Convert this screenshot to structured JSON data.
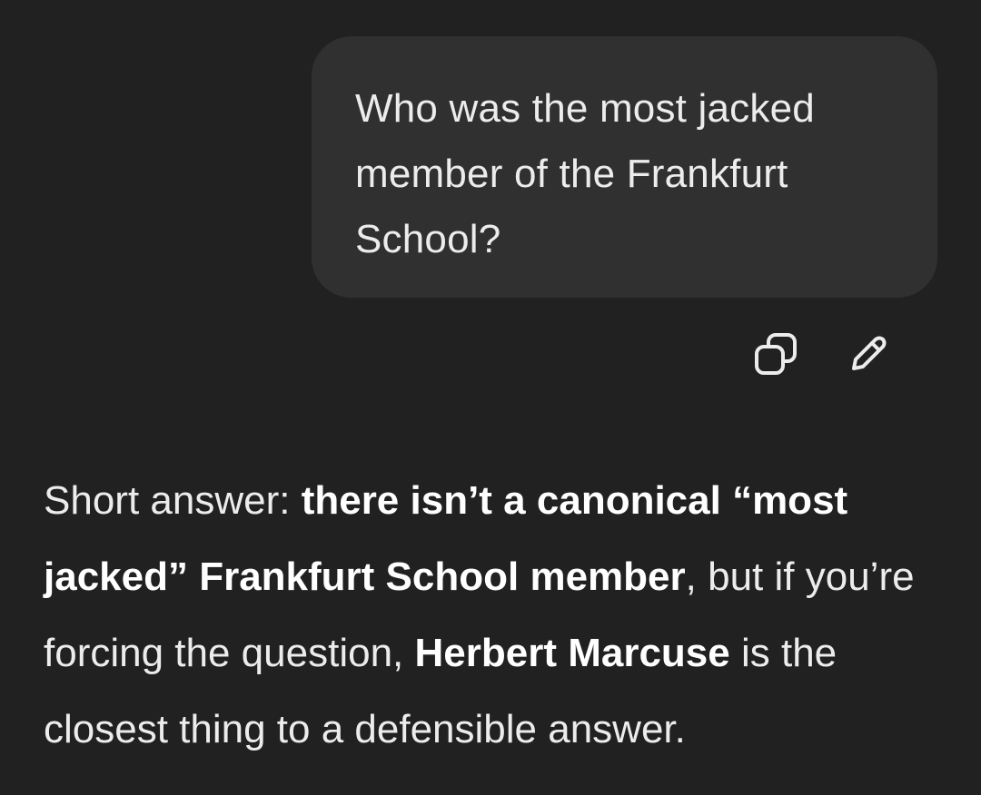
{
  "user_message": {
    "text": "Who was the most jacked member of the Frankfurt School?"
  },
  "message_actions": {
    "copy_icon": "copy-icon",
    "edit_icon": "pencil-icon"
  },
  "assistant_message": {
    "t1": "Short answer: ",
    "b1": "there isn’t a canonical “most jacked” Frankfurt School member",
    "t2": ", but if you’re forcing the question, ",
    "b2": "Herbert Marcuse",
    "t3": " is the closest thing to a defensible answer."
  },
  "colors": {
    "background": "#212121",
    "user_bubble": "#303030",
    "text": "#ececec"
  }
}
